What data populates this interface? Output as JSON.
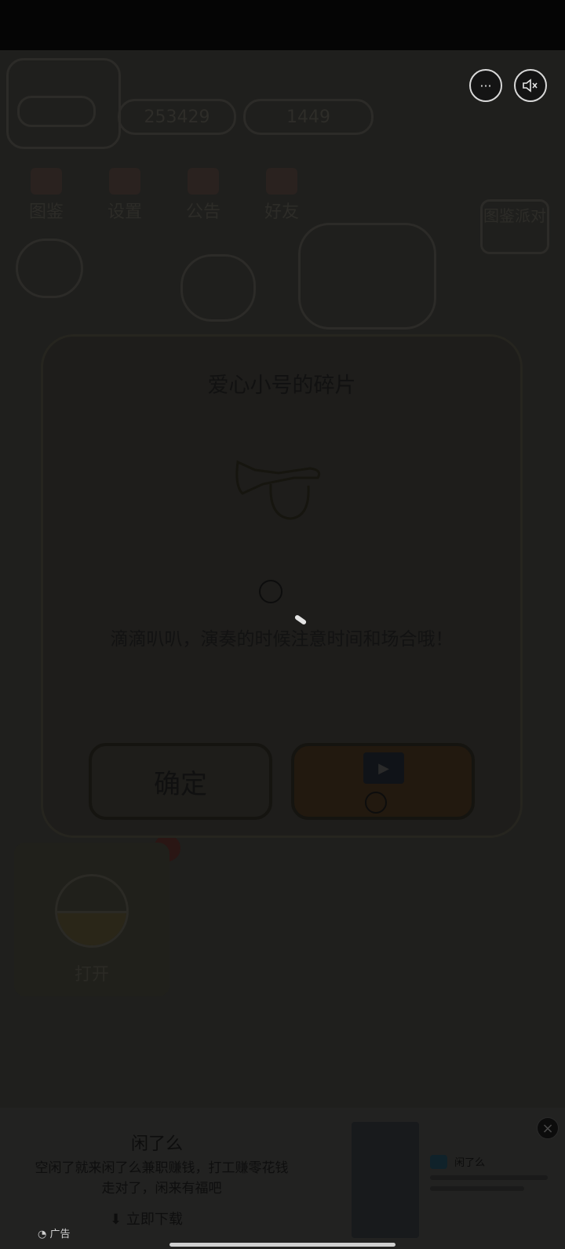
{
  "game": {
    "coins": "253429",
    "gems": "1449",
    "menu": [
      {
        "label": "图鉴",
        "icon": "book-icon"
      },
      {
        "label": "设置",
        "icon": "gear-icon"
      },
      {
        "label": "公告",
        "icon": "megaphone-icon"
      },
      {
        "label": "好友",
        "icon": "friends-icon"
      }
    ],
    "party_label": "图鉴派对",
    "open_label": "打开"
  },
  "top_buttons": {
    "more": "···"
  },
  "dialog": {
    "title": "爱心小号的碎片",
    "description": "滴滴叭叭，演奏的时候注意时间和场合哦！",
    "confirm_label": "确定",
    "video_play": "▶"
  },
  "ad": {
    "title": "闲了么",
    "description_line1": "空闲了就来闲了么兼职赚钱，打工赚零花钱",
    "description_line2": "走对了，闲来有福吧",
    "download_label": "立即下载",
    "badge": "广告",
    "app_name": "闲了么",
    "close": "×"
  }
}
